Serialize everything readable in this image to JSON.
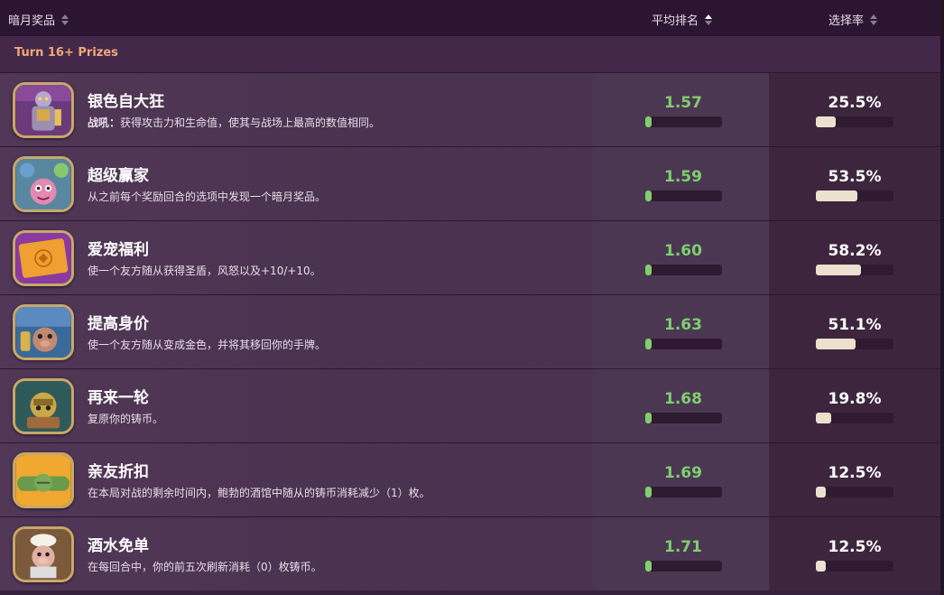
{
  "header": {
    "col_name": "暗月奖品",
    "col_rank": "平均排名",
    "col_pick": "选择率"
  },
  "section": {
    "label": "Turn 16+ Prizes"
  },
  "colors": {
    "rank_green": "#7fcf6e",
    "section_orange": "#f0a878",
    "pick_fill": "#ece0cf",
    "frame_gold": "#c8a76a"
  },
  "rows": [
    {
      "title": "银色自大狂",
      "desc_bold": "战吼：",
      "desc": "获得攻击力和生命值，使其与战场上最高的数值相同。",
      "rank": "1.57",
      "rank_fill": 0.08,
      "pick": "25.5%",
      "pick_fill": 0.255,
      "icon": "silver-armored-knight-icon"
    },
    {
      "title": "超级赢家",
      "desc_bold": "",
      "desc": "从之前每个奖励回合的选项中发现一个暗月奖品。",
      "rank": "1.59",
      "rank_fill": 0.08,
      "pick": "53.5%",
      "pick_fill": 0.535,
      "icon": "pink-creature-icon"
    },
    {
      "title": "爱宠福利",
      "desc_bold": "",
      "desc": "使一个友方随从获得圣盾，风怒以及+10/+10。",
      "rank": "1.60",
      "rank_fill": 0.08,
      "pick": "58.2%",
      "pick_fill": 0.582,
      "icon": "orange-ticket-icon"
    },
    {
      "title": "提高身价",
      "desc_bold": "",
      "desc": "使一个友方随从变成金色，并将其移回你的手牌。",
      "rank": "1.63",
      "rank_fill": 0.08,
      "pick": "51.1%",
      "pick_fill": 0.511,
      "icon": "goblin-pig-icon"
    },
    {
      "title": "再来一轮",
      "desc_bold": "",
      "desc": "复原你的铸币。",
      "rank": "1.68",
      "rank_fill": 0.08,
      "pick": "19.8%",
      "pick_fill": 0.198,
      "icon": "gold-goblin-icon"
    },
    {
      "title": "亲友折扣",
      "desc_bold": "",
      "desc": "在本局对战的剩余时间内，鲍勃的酒馆中随从的铸币消耗减少（1）枚。",
      "rank": "1.69",
      "rank_fill": 0.08,
      "pick": "12.5%",
      "pick_fill": 0.125,
      "icon": "handshake-icon"
    },
    {
      "title": "酒水免单",
      "desc_bold": "",
      "desc": "在每回合中，你的前五次刷新消耗（0）枚铸币。",
      "rank": "1.71",
      "rank_fill": 0.08,
      "pick": "12.5%",
      "pick_fill": 0.125,
      "icon": "pig-chef-icon"
    }
  ]
}
